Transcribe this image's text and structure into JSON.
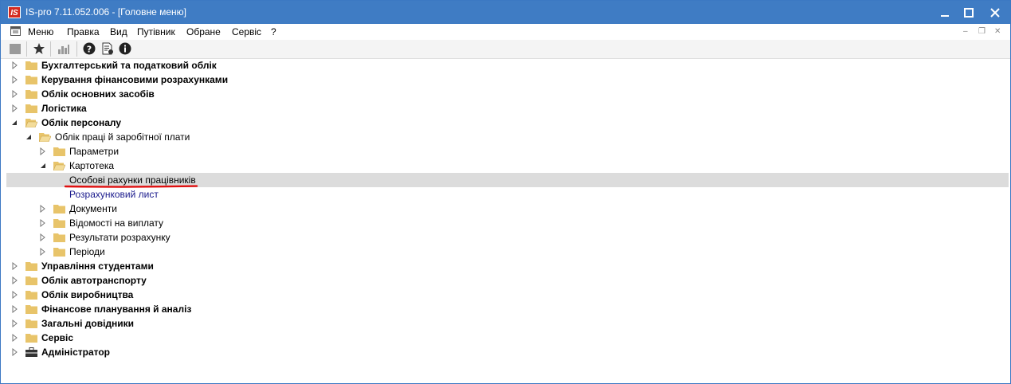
{
  "window": {
    "title": "IS-pro 7.11.052.006 - [Головне меню]",
    "logo_text": "IS"
  },
  "menu": {
    "items": [
      "Меню",
      "Правка",
      "Вид",
      "Путівник",
      "Обране",
      "Сервіс",
      "?"
    ]
  },
  "toolbar": {
    "icons": [
      "grey-folder-icon",
      "star-icon",
      "chart-icon",
      "help-icon",
      "document-settings-icon",
      "info-icon"
    ]
  },
  "tree": {
    "items": [
      {
        "label": "Бухгалтерський та податковий облік",
        "bold": true,
        "expanded": false
      },
      {
        "label": "Керування фінансовими розрахунками",
        "bold": true,
        "expanded": false
      },
      {
        "label": "Облік основних засобів",
        "bold": true,
        "expanded": false
      },
      {
        "label": "Логістика",
        "bold": true,
        "expanded": false
      },
      {
        "label": "Облік персоналу",
        "bold": true,
        "expanded": true
      },
      {
        "label": "Облік праці й заробітної плати",
        "bold": false,
        "expanded": true
      },
      {
        "label": "Параметри",
        "bold": false,
        "expanded": false
      },
      {
        "label": "Картотека",
        "bold": false,
        "expanded": true
      },
      {
        "label": "Особові рахунки працівників",
        "bold": false,
        "selected": true
      },
      {
        "label": "Розрахунковий лист",
        "bold": false
      },
      {
        "label": "Документи",
        "bold": false,
        "expanded": false
      },
      {
        "label": "Відомості на виплату",
        "bold": false,
        "expanded": false
      },
      {
        "label": "Результати розрахунку",
        "bold": false,
        "expanded": false
      },
      {
        "label": "Періоди",
        "bold": false,
        "expanded": false
      },
      {
        "label": "Управління студентами",
        "bold": true,
        "expanded": false
      },
      {
        "label": "Облік автотранспорту",
        "bold": true,
        "expanded": false
      },
      {
        "label": "Облік виробництва",
        "bold": true,
        "expanded": false
      },
      {
        "label": "Фінансове планування й аналіз",
        "bold": true,
        "expanded": false
      },
      {
        "label": "Загальні довідники",
        "bold": true,
        "expanded": false
      },
      {
        "label": "Сервіс",
        "bold": true,
        "expanded": false
      },
      {
        "label": "Адміністратор",
        "bold": true,
        "expanded": false
      }
    ]
  },
  "colors": {
    "titlebar": "#3f7cc4",
    "selection": "#dcdcdc",
    "highlight_underline": "#e01010",
    "folder": "#e8c46a"
  }
}
